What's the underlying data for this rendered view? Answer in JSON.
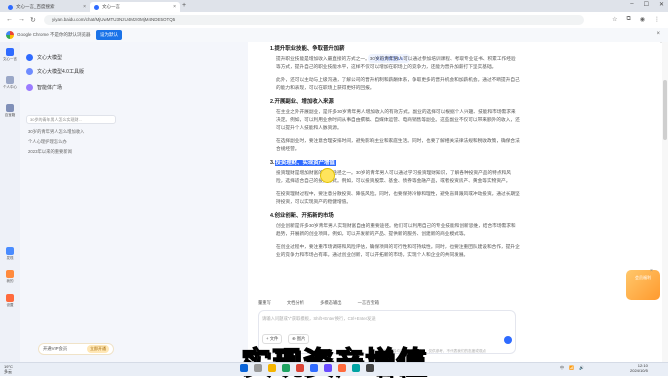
{
  "browser": {
    "tabs": [
      {
        "label": "文心一言_百度搜索"
      },
      {
        "label": "文心一言"
      }
    ],
    "new_tab": "+",
    "window_controls": {
      "minimize": "–",
      "maximize": "☐",
      "close": "✕"
    },
    "url": "yiyan.baidu.com/chat/MjUwMTU3NzU4MzI0MjM4NDE5OTQ5",
    "info_bar": {
      "text": "Google Chrome 不是你的默认浏览器",
      "button": "设为默认"
    }
  },
  "rail": {
    "items": [
      {
        "label": "文心一言"
      },
      {
        "label": "个人中心"
      },
      {
        "label": "百宝箱"
      },
      {
        "label": "发现"
      },
      {
        "label": "我的"
      },
      {
        "label": "设置"
      }
    ]
  },
  "sidebar": {
    "items": [
      {
        "label": "文心大模型"
      },
      {
        "label": "文心大模型4.0工具版"
      },
      {
        "label": "智能体广场"
      }
    ],
    "search_placeholder": "30岁的青年男人怎么实现财...",
    "history": [
      "30岁的青年男人怎么增加收入",
      "个人心理护理怎么办",
      "2023年以来的重要新闻"
    ],
    "vip": {
      "text": "开通VIP会员",
      "button": "立即开通"
    }
  },
  "document": {
    "tooltip": "文心大模型3.5",
    "sections": [
      {
        "heading": "1.提升职业技能、争取晋升加薪",
        "paragraphs": [
          "提升职业技能是增加收入最直接的方式之一。30岁的青年男人可以通过参加培训课程、考取专业证书、积累工作经验等方式，提升自己的职业技能水平，这样不仅可以增加在职场上的竞争力，还能为晋升加薪打下坚实基础。",
          "此外，还可以主动与上级沟通，了解公司的晋升机制和薪酬体系，争取更多的晋升机会和加薪机会。通过不断提升自己的能力和表现，可以在职场上获得更好的回报。"
        ]
      },
      {
        "heading": "2.开展副业、增加收入来源",
        "paragraphs": [
          "在主业之外开展副业，是许多30岁青年男人增加收入的有效方式。副业的选择可以根据个人兴趣、技能和市场需求来决定。例如，可以利用业余时间从事自由撰稿、自媒体运营、电商销售等副业。这些副业不仅可以带来额外的收入，还可以提升个人技能和人脉资源。",
          "在选择副业时，要注意合理安排时间，避免影响主业和家庭生活。同时，也要了解相关法律法规和税收政策，确保合法合规经营。"
        ]
      },
      {
        "heading_prefix": "3.",
        "heading_highlight": "投资理财、实现资产增值",
        "paragraphs": [
          "投资理财是增加财富的重要途径之一。30岁的青年男人可以通过学习投资理财知识，了解各种投资产品的特点和风险，选择适合自己的投资方式。例如，可以投资股票、基金、债券等金融产品，或者投资房产、黄金等实物资产。",
          "在投资理财过程中，要注意分散投资、降低风险。同时，也要保持冷静和理性，避免盲目跟风或冲动投资。通过长期坚持投资，可以实现资产的稳健增值。"
        ]
      },
      {
        "heading": "4.创业创新、开拓新的市场",
        "paragraphs": [
          "创业创新是许多30岁青年男人实现财富自由的重要途径。他们可以利用自己的专业技能和创新思维，结合市场需求和趋势，开展新的创业项目。例如，可以开发新的产品、提供新的服务、创建新的商业模式等。",
          "在创业过程中，要注重市场调研和风险评估，确保项目的可行性和可持续性。同时，也要注重团队建设和合作，提升企业的竞争力和市场占有率。通过创业创新，可以开拓新的市场，实现个人和企业的共同发展。"
        ]
      }
    ]
  },
  "input": {
    "tools": [
      "量重写",
      "文档分析",
      "多模态输出",
      "一言百宝箱"
    ],
    "placeholder": "请输入问题或“/”获取模板，Shift+Enter换行，Ctrl+Enter发送",
    "chip_a": "+ 文件",
    "chip_b": "⊕ 图片",
    "disclaimer": "所有内容均由AI大模型输出，仅供参考，不代表我们的态度或观点"
  },
  "ad": {
    "text": "会员福利"
  },
  "caption": "实现资产增值",
  "taskbar": {
    "weather_temp": "19°C",
    "weather_desc": "多云",
    "time": "12:10",
    "date": "2024/10/5",
    "lang": "中",
    "tray_volume": "🔊",
    "tray_network": "📶"
  },
  "colors": {
    "accent": "#2f6bff",
    "caption_stroke": "#000000"
  }
}
